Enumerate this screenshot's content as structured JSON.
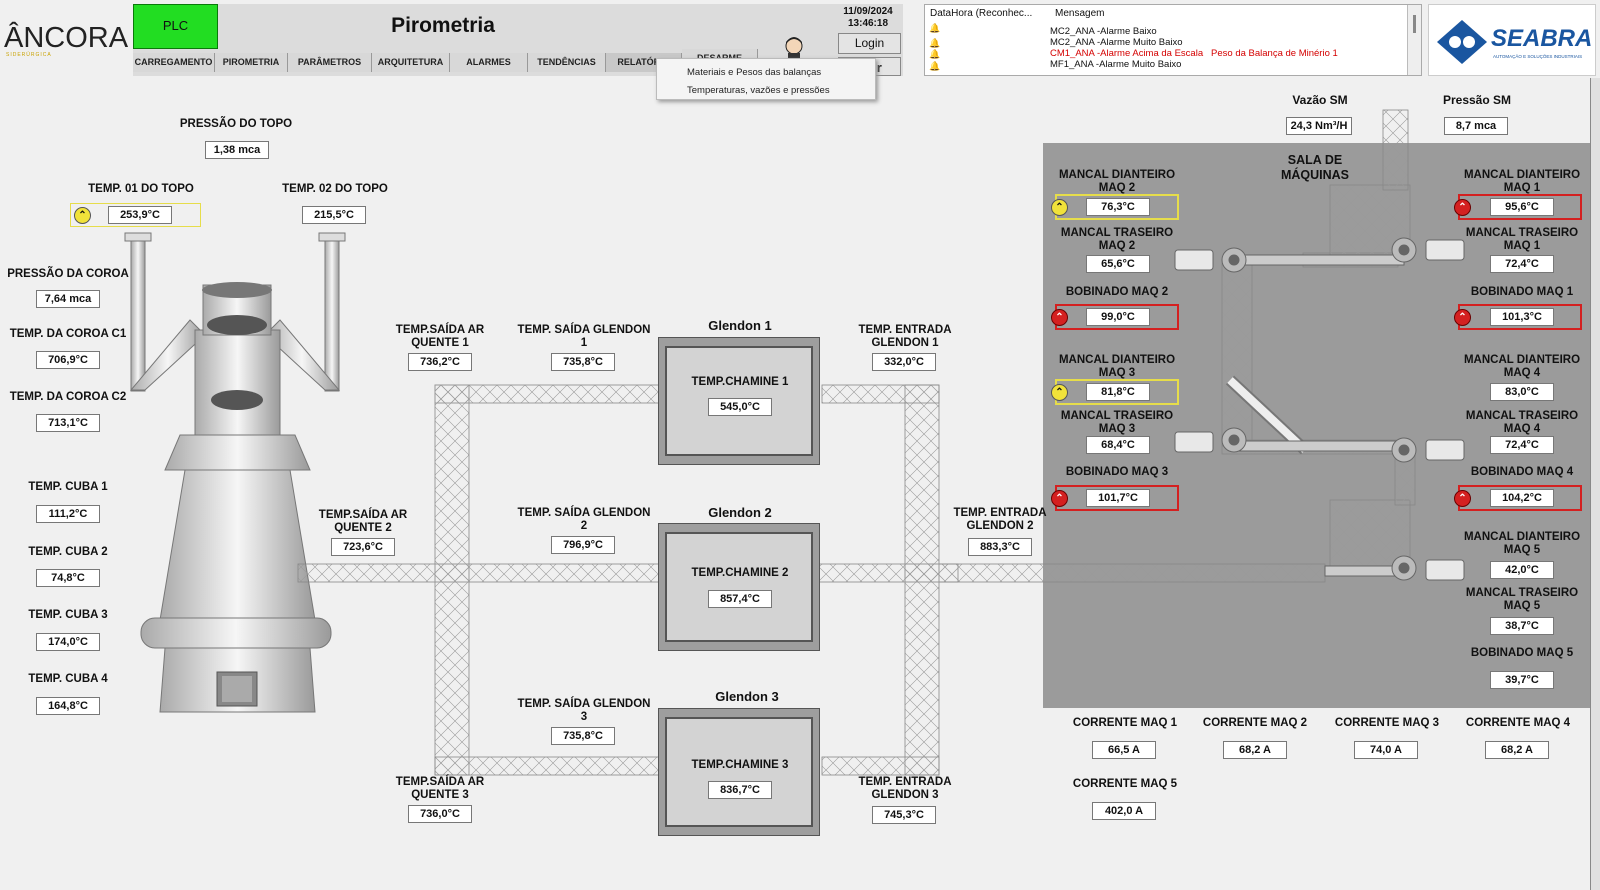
{
  "header": {
    "brand_left": "ÂNCORA",
    "brand_left_sub": "SIDERÚRGICA",
    "plc": "PLC",
    "title": "Pirometria",
    "date": "11/09/2024",
    "time": "13:46:18",
    "login": "Login",
    "exit": "Sair",
    "brand_right": "SEABRA",
    "brand_right_sub": "AUTOMAÇÃO E SOLUÇÕES INDUSTRIAIS",
    "tabs": [
      "CARREGAMENTO",
      "PIROMETRIA",
      "PARÂMETROS",
      "ARQUITETURA",
      "ALARMES",
      "TENDÊNCIAS",
      "RELATÓRIO",
      "DESARME"
    ]
  },
  "dropdown": {
    "items": [
      "Materiais e Pesos das balanças",
      "Temperaturas, vazões e pressões"
    ]
  },
  "alarms": {
    "col1": "DataHora (Reconhec...",
    "col2": "Mensagem",
    "rows": [
      {
        "msg": "MC2_ANA -Alarme  Baixo",
        "color": "#111111"
      },
      {
        "msg": "MC2_ANA -Alarme Muito Baixo",
        "color": "#111111"
      },
      {
        "msg": "CM1_ANA -Alarme Acima da Escala   Peso da Balança de Minério 1",
        "color": "#d40000"
      },
      {
        "msg": "MF1_ANA -Alarme Muito Baixo",
        "color": "#111111"
      }
    ]
  },
  "furnace": {
    "pressao_topo_label": "PRESSÃO DO TOPO",
    "pressao_topo": "1,38 mca",
    "temp01_label": "TEMP. 01 DO TOPO",
    "temp01": "253,9°C",
    "temp02_label": "TEMP. 02 DO TOPO",
    "temp02": "215,5°C",
    "pressao_coroa_label": "PRESSÃO DA COROA",
    "pressao_coroa": "7,64 mca",
    "coroa_c1_label": "TEMP. DA COROA C1",
    "coroa_c1": "706,9°C",
    "coroa_c2_label": "TEMP. DA COROA C2",
    "coroa_c2": "713,1°C",
    "cuba1_label": "TEMP. CUBA 1",
    "cuba1": "111,2°C",
    "cuba2_label": "TEMP. CUBA 2",
    "cuba2": "74,8°C",
    "cuba3_label": "TEMP. CUBA 3",
    "cuba3": "174,0°C",
    "cuba4_label": "TEMP. CUBA 4",
    "cuba4": "164,8°C"
  },
  "glendon": {
    "saida_ar1_label": "TEMP.SAÍDA AR QUENTE 1",
    "saida_ar1": "736,2°C",
    "saida_ar2_label": "TEMP.SAÍDA AR QUENTE 2",
    "saida_ar2": "723,6°C",
    "saida_ar3_label": "TEMP.SAÍDA AR QUENTE 3",
    "saida_ar3": "736,0°C",
    "saida_g1_label": "TEMP. SAÍDA GLENDON 1",
    "saida_g1": "735,8°C",
    "saida_g2_label": "TEMP. SAÍDA GLENDON 2",
    "saida_g2": "796,9°C",
    "saida_g3_label": "TEMP. SAÍDA GLENDON 3",
    "saida_g3": "735,8°C",
    "entrada_g1_label": "TEMP. ENTRADA GLENDON 1",
    "entrada_g1": "332,0°C",
    "entrada_g2_label": "TEMP. ENTRADA GLENDON 2",
    "entrada_g2": "883,3°C",
    "entrada_g3_label": "TEMP. ENTRADA GLENDON 3",
    "entrada_g3": "745,3°C",
    "g1_title": "Glendon 1",
    "g2_title": "Glendon 2",
    "g3_title": "Glendon 3",
    "chamine1_label": "TEMP.CHAMINE 1",
    "chamine1": "545,0°C",
    "chamine2_label": "TEMP.CHAMINE 2",
    "chamine2": "857,4°C",
    "chamine3_label": "TEMP.CHAMINE 3",
    "chamine3": "836,7°C"
  },
  "machines": {
    "sala_label": "SALA DE MÁQUINAS",
    "vazao_label": "Vazão SM",
    "vazao": "24,3 Nm³/H",
    "pressao_label": "Pressão SM",
    "pressao": "8,7 mca",
    "md2_label": "MANCAL DIANTEIRO MAQ 2",
    "md2": "76,3°C",
    "mt2_label": "MANCAL TRASEIRO MAQ 2",
    "mt2": "65,6°C",
    "b2_label": "BOBINADO MAQ 2",
    "b2": "99,0°C",
    "md3_label": "MANCAL DIANTEIRO MAQ 3",
    "md3": "81,8°C",
    "mt3_label": "MANCAL TRASEIRO MAQ 3",
    "mt3": "68,4°C",
    "b3_label": "BOBINADO MAQ 3",
    "b3": "101,7°C",
    "md1_label": "MANCAL DIANTEIRO MAQ 1",
    "md1": "95,6°C",
    "mt1_label": "MANCAL TRASEIRO MAQ 1",
    "mt1": "72,4°C",
    "b1_label": "BOBINADO MAQ 1",
    "b1": "101,3°C",
    "md4_label": "MANCAL DIANTEIRO MAQ 4",
    "md4": "83,0°C",
    "mt4_label": "MANCAL TRASEIRO MAQ 4",
    "mt4": "72,4°C",
    "b4_label": "BOBINADO MAQ 4",
    "b4": "104,2°C",
    "md5_label": "MANCAL DIANTEIRO MAQ 5",
    "md5": "42,0°C",
    "mt5_label": "MANCAL TRASEIRO MAQ 5",
    "mt5": "38,7°C",
    "b5_label": "BOBINADO MAQ 5",
    "b5": "39,7°C",
    "c1_label": "CORRENTE MAQ 1",
    "c1": "66,5 A",
    "c2_label": "CORRENTE MAQ 2",
    "c2": "68,2 A",
    "c3_label": "CORRENTE MAQ 3",
    "c3": "74,0 A",
    "c4_label": "CORRENTE MAQ 4",
    "c4": "68,2 A",
    "c5_label": "CORRENTE MAQ 5",
    "c5": "402,0 A"
  },
  "colors": {
    "plc": "#22dd22",
    "alarm_red": "#d42020",
    "alarm_yellow": "#e6dd4a",
    "machine_room": "#9b9b9b"
  },
  "icons": {
    "warn_yellow": "chevron-up-icon",
    "warn_red": "double-chevron-up-icon",
    "operator": "operator-icon",
    "bell": "bell-icon"
  }
}
